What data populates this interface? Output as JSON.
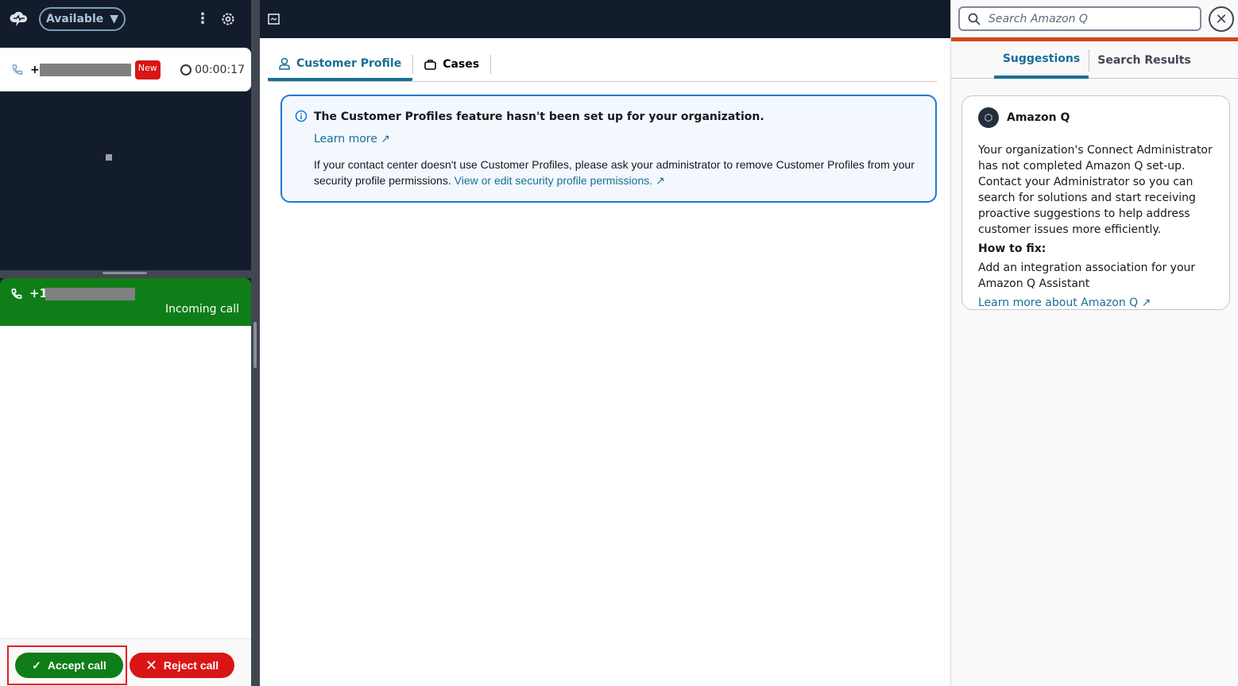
{
  "left": {
    "status": "Available",
    "contact": {
      "phone_prefix": "+",
      "badge": "New",
      "timer": "00:00:17"
    },
    "incoming": {
      "phone_prefix": "+1",
      "label": "Incoming call"
    },
    "accept_label": "Accept call",
    "reject_label": "Reject call"
  },
  "main": {
    "tabs": [
      {
        "label": "Customer Profile",
        "icon": "user-icon"
      },
      {
        "label": "Cases",
        "icon": "briefcase-icon"
      }
    ],
    "alert": {
      "title": "The Customer Profiles feature hasn't been set up for your organization.",
      "learn_more": "Learn more",
      "body": "If your contact center doesn't use Customer Profiles, please ask your administrator to remove Customer Profiles from your security profile permissions.",
      "link": "View or edit security profile permissions."
    }
  },
  "right": {
    "search_placeholder": "Search Amazon Q",
    "tabs": [
      "Suggestions",
      "Search Results"
    ],
    "card": {
      "title": "Amazon Q",
      "body": "Your organization's Connect Administrator has not completed Amazon Q set-up. Contact your Administrator so you can search for solutions and start receiving proactive suggestions to help address customer issues more efficiently.",
      "howto": "How to fix:",
      "fix": "Add an integration association for your Amazon Q Assistant",
      "link": "Learn more about Amazon Q"
    }
  },
  "colors": {
    "accent": "#1a6f96",
    "green": "#0f7e18",
    "red": "#d91515",
    "orange": "#d4461a",
    "dark": "#121c2c"
  }
}
